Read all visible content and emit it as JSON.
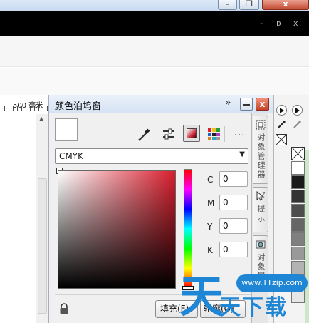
{
  "window": {
    "outer_controls": {
      "minimize": "–",
      "restore": "❐",
      "close": "x"
    },
    "inner_controls": {
      "minimize": "–",
      "restore": "ᴅ",
      "close": "x"
    }
  },
  "ruler": {
    "label": "500 毫米"
  },
  "docker": {
    "title": "颜色泊坞窗",
    "expand_glyph": "»",
    "close_glyph": "x",
    "more_glyph": "...",
    "color_model": {
      "selected": "CMYK",
      "arrow": "▼"
    },
    "channels": [
      {
        "label": "C",
        "value": "0"
      },
      {
        "label": "M",
        "value": "0"
      },
      {
        "label": "Y",
        "value": "0"
      },
      {
        "label": "K",
        "value": "0"
      }
    ],
    "buttons": {
      "fill": "填充(F)",
      "outline": "轮廓(O)"
    },
    "current_color": "#ffffff",
    "area_hue_color": "#d81e2d"
  },
  "docker_tabs": [
    {
      "label": "对象管理器",
      "icon": "object-manager-icon"
    },
    {
      "label": "提示",
      "icon": "hints-icon"
    },
    {
      "label": "对象属",
      "icon": "object-properties-icon"
    }
  ],
  "watermark": {
    "big_char": "天",
    "url": "www.TTzip.com",
    "text": "天下载"
  },
  "palette": {
    "swatches": [
      "#ffffff",
      "#1a1a1a",
      "#333333",
      "#4d4d4d",
      "#666666",
      "#7f7f7f",
      "#999999",
      "#b3b3b3",
      "#cccccc",
      "#e6e6e6"
    ]
  }
}
